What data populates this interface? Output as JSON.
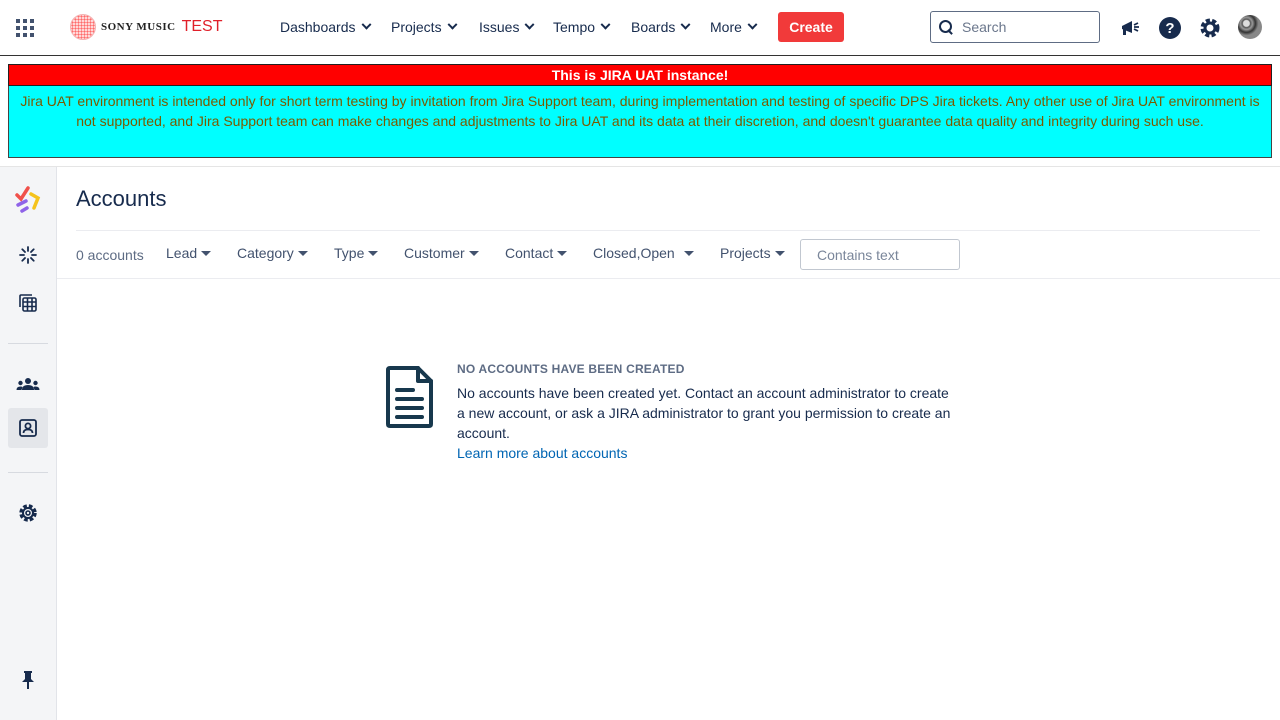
{
  "header": {
    "brand": "SONY MUSIC",
    "env_label": "TEST",
    "nav": [
      {
        "label": "Dashboards"
      },
      {
        "label": "Projects"
      },
      {
        "label": "Issues"
      },
      {
        "label": "Tempo"
      },
      {
        "label": "Boards"
      },
      {
        "label": "More"
      }
    ],
    "create_label": "Create",
    "search_placeholder": "Search"
  },
  "banner": {
    "title": "This is JIRA UAT instance!",
    "body": "Jira UAT environment is intended only for short term testing by invitation from Jira Support team, during implementation and testing of specific DPS Jira tickets. Any other use of Jira UAT environment is not supported, and Jira Support team can make changes and adjustments to Jira UAT and its data at their discretion, and doesn't guarantee data quality and integrity during such use.",
    "title_bg": "#ff0000",
    "body_bg": "#00ffff"
  },
  "sidebar": {
    "icons": [
      "tempo-logo-icon",
      "loading-spinner-icon",
      "calendar-grid-icon",
      "team-icon",
      "accounts-contact-icon",
      "settings-gear-icon",
      "pin-icon"
    ],
    "active": "accounts-contact-icon"
  },
  "main": {
    "title": "Accounts",
    "count_label": "0 accounts",
    "filters": [
      {
        "label": "Lead"
      },
      {
        "label": "Category"
      },
      {
        "label": "Type"
      },
      {
        "label": "Customer"
      },
      {
        "label": "Contact"
      },
      {
        "label": "Closed,Open"
      },
      {
        "label": "Projects"
      }
    ],
    "text_filter_placeholder": "Contains text"
  },
  "empty_state": {
    "heading": "NO ACCOUNTS HAVE BEEN CREATED",
    "body": "No accounts have been created yet. Contact an account administrator to create a new account, or ask a JIRA administrator to grant you permission to create an account.",
    "link": "Learn more about accounts",
    "icon": "document-icon"
  },
  "colors": {
    "create_button": "#f13a3a",
    "link": "#0065b3",
    "text": "#172b4d"
  }
}
